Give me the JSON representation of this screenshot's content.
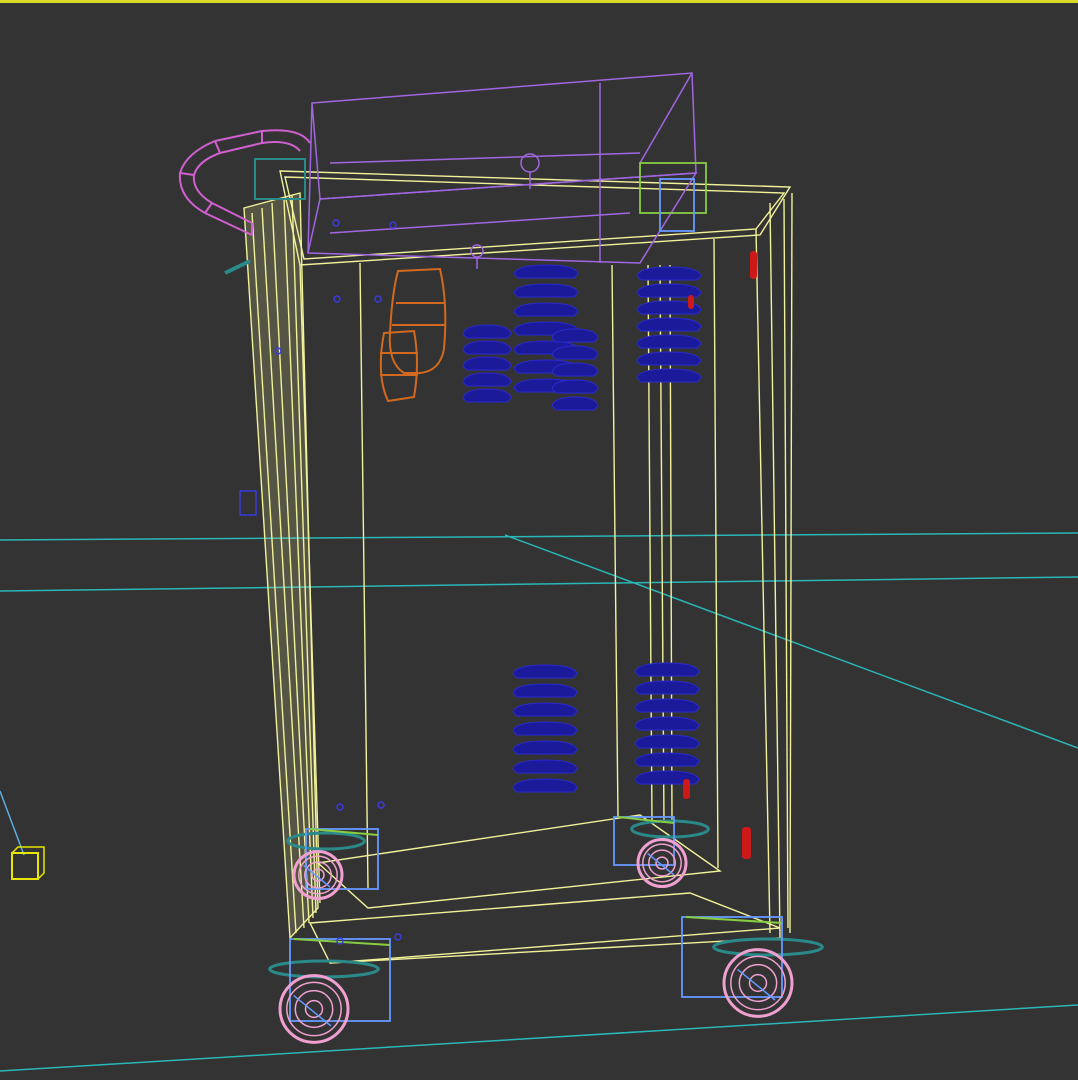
{
  "viewport": {
    "mode": "wireframe",
    "active_border_color": "#d9d92a",
    "background_color": "#333333",
    "grid_color": "#2ab7b7"
  },
  "scene": {
    "object_colors": {
      "cart_body": "#f2f29a",
      "monitor_box": "#a066e0",
      "handle": "#d060d0",
      "vents": "#1a1a9a",
      "bottle": "#d2691e",
      "caster_frame": "#6699ff",
      "caster_wheel": "#f0a0d0",
      "caster_plate": "#88cc44",
      "wheel_guard": "#2a8a8a",
      "red_markers": "#cc1a1a",
      "light_helper": "#e6e600"
    },
    "objects": [
      "monitor-box",
      "cart-handle",
      "cart-body",
      "bottle-holder",
      "vent-grilles",
      "casters",
      "light-helper"
    ]
  }
}
